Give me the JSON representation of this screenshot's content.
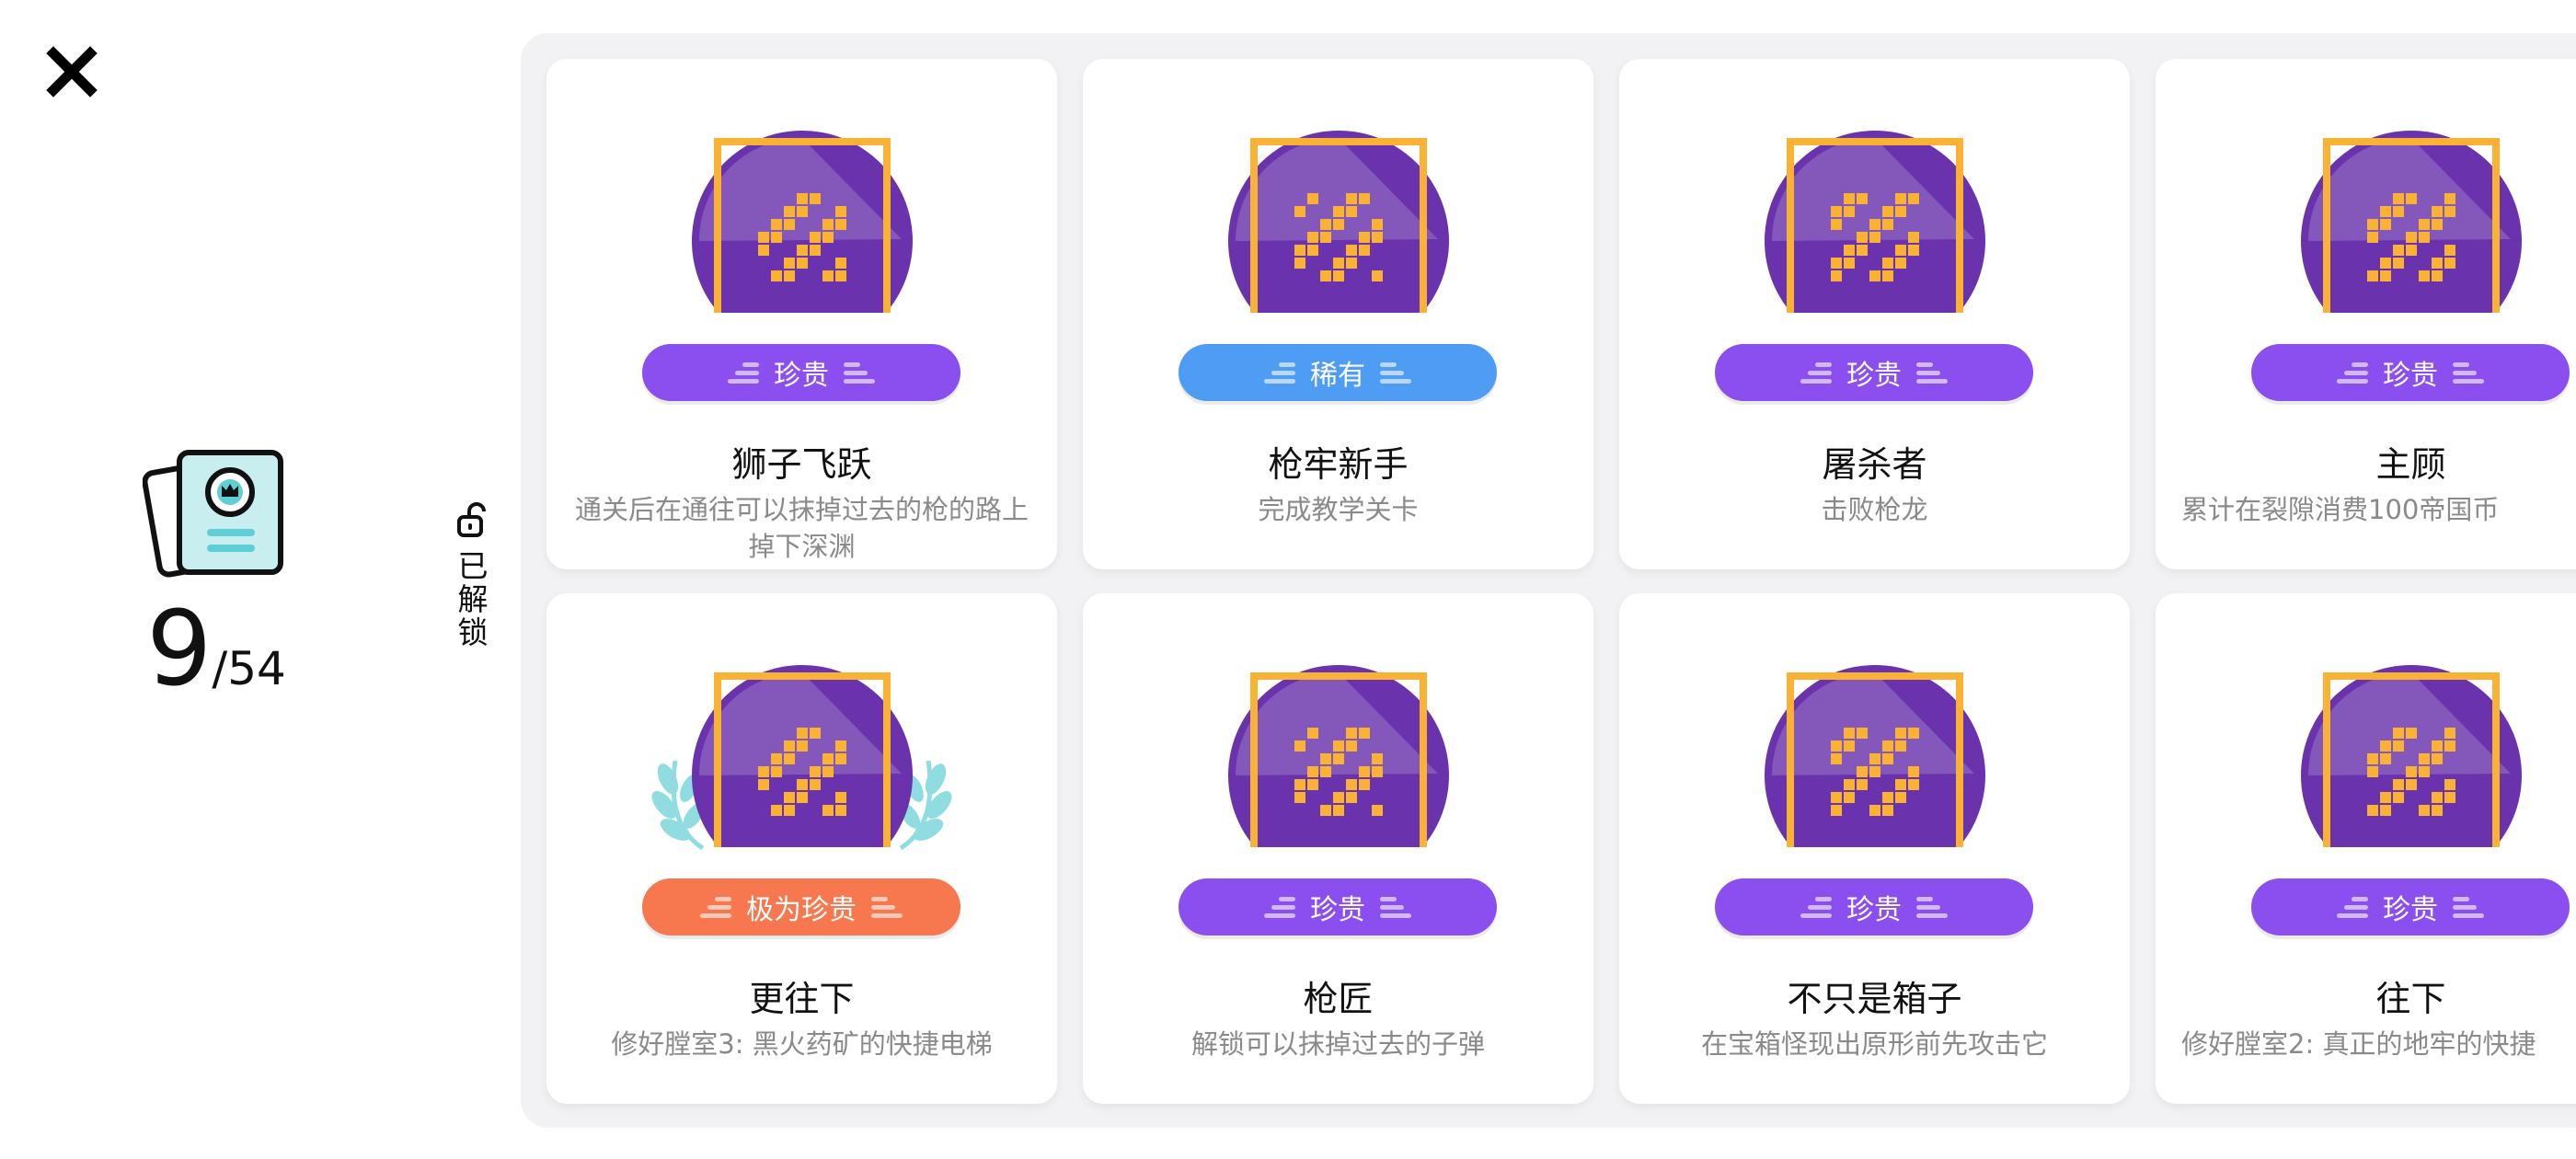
{
  "colors": {
    "precious": "#8b4ff0",
    "rare": "#4f9cf5",
    "extremely_precious": "#f7784f",
    "medal_purple": "#6a32ad",
    "medal_gold": "#f9b233",
    "laurel": "#8fdde0"
  },
  "close_icon": "close-icon",
  "progress": {
    "unlocked": "9",
    "separator": "/",
    "total": "54"
  },
  "filter": {
    "label": "已解锁",
    "icon": "unlock-icon"
  },
  "achievements": [
    {
      "title": "狮子飞跃",
      "desc": "通关后在通往可以抹掉过去的枪的路上掉下深渊",
      "rarity": "珍贵",
      "rarity_key": "precious",
      "icon": "lion-leap-icon"
    },
    {
      "title": "枪牢新手",
      "desc": "完成教学关卡",
      "rarity": "稀有",
      "rarity_key": "rare",
      "icon": "hunter-portrait-icon"
    },
    {
      "title": "屠杀者",
      "desc": "击败枪龙",
      "rarity": "珍贵",
      "rarity_key": "precious",
      "icon": "dragon-skull-icon"
    },
    {
      "title": "主顾",
      "desc": "累计在裂隙消费100帝国币",
      "rarity": "珍贵",
      "rarity_key": "precious",
      "icon": "coin-stack-icon"
    },
    {
      "title": "更往下",
      "desc": "修好膛室3: 黑火药矿的快捷电梯",
      "rarity": "极为珍贵",
      "rarity_key": "extremely_precious",
      "icon": "elevator-icon"
    },
    {
      "title": "枪匠",
      "desc": "解锁可以抹掉过去的子弹",
      "rarity": "珍贵",
      "rarity_key": "precious",
      "icon": "bullet-smith-icon"
    },
    {
      "title": "不只是箱子",
      "desc": "在宝箱怪现出原形前先攻击它",
      "rarity": "珍贵",
      "rarity_key": "precious",
      "icon": "mimic-chest-icon"
    },
    {
      "title": "往下",
      "desc": "修好膛室2: 真正的地牢的快捷",
      "rarity": "珍贵",
      "rarity_key": "precious",
      "icon": "elevator-down-icon"
    }
  ]
}
